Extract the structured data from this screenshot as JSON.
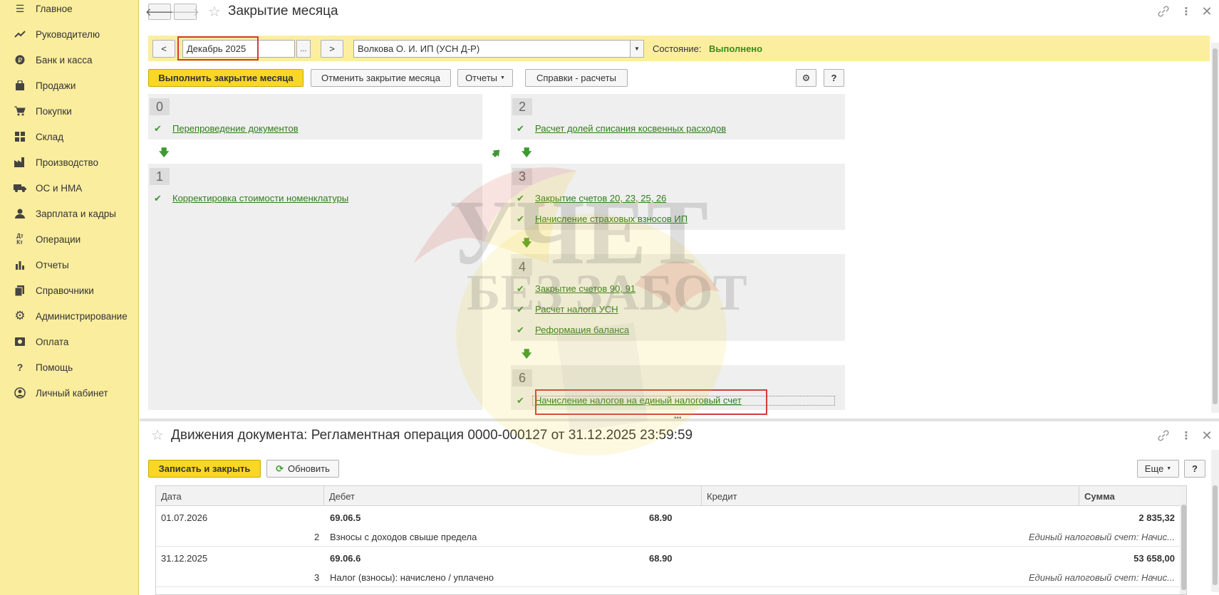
{
  "sidebar": {
    "items": [
      {
        "label": "Главное",
        "icon": "menu-icon"
      },
      {
        "label": "Руководителю",
        "icon": "trend-icon"
      },
      {
        "label": "Банк и касса",
        "icon": "ruble-icon"
      },
      {
        "label": "Продажи",
        "icon": "bag-icon"
      },
      {
        "label": "Покупки",
        "icon": "cart-icon"
      },
      {
        "label": "Склад",
        "icon": "warehouse-icon"
      },
      {
        "label": "Производство",
        "icon": "factory-icon"
      },
      {
        "label": "ОС и НМА",
        "icon": "truck-icon"
      },
      {
        "label": "Зарплата и кадры",
        "icon": "person-icon"
      },
      {
        "label": "Операции",
        "icon": "debit-credit-icon"
      },
      {
        "label": "Отчеты",
        "icon": "bar-chart-icon"
      },
      {
        "label": "Справочники",
        "icon": "books-icon"
      },
      {
        "label": "Администрирование",
        "icon": "gear-icon"
      },
      {
        "label": "Оплата",
        "icon": "payment-icon"
      },
      {
        "label": "Помощь",
        "icon": "question-icon"
      },
      {
        "label": "Личный кабинет",
        "icon": "account-icon"
      }
    ]
  },
  "top_form": {
    "title": "Закрытие месяца",
    "period_prev": "<",
    "period_value": "Декабрь 2025",
    "period_select": "...",
    "period_next": ">",
    "organization": "Волкова О. И. ИП (УСН Д-Р)",
    "state_label": "Состояние:",
    "state_value": "Выполнено",
    "state_color": "#3a8a1c",
    "buttons": {
      "run": "Выполнить закрытие месяца",
      "cancel": "Отменить закрытие месяца",
      "reports": "Отчеты",
      "calcs": "Справки - расчеты",
      "help": "?"
    },
    "steps": [
      {
        "num": "0",
        "ops": [
          "Перепроведение документов"
        ]
      },
      {
        "num": "1",
        "ops": [
          "Корректировка стоимости номенклатуры"
        ]
      },
      {
        "num": "2",
        "ops": [
          "Расчет долей списания косвенных расходов"
        ]
      },
      {
        "num": "3",
        "ops": [
          "Закрытие счетов 20, 23, 25, 26",
          "Начисление страховых взносов ИП"
        ]
      },
      {
        "num": "4",
        "ops": [
          "Закрытие счетов 90, 91",
          "Расчет налога УСН",
          "Реформация баланса"
        ]
      },
      {
        "num": "6",
        "ops": [
          "Начисление налогов на единый налоговый счет"
        ]
      }
    ]
  },
  "bottom_form": {
    "title": "Движения документа: Регламентная операция 0000-000127 от 31.12.2025 23:59:59",
    "save_close": "Записать и закрыть",
    "refresh": "Обновить",
    "more": "Еще",
    "help": "?",
    "columns": [
      "Дата",
      "Дебет",
      "Кредит",
      "Сумма"
    ],
    "rows": [
      {
        "date": "01.07.2026",
        "num": "2",
        "debit": "69.06.5",
        "debit_sub": "Взносы с доходов свыше предела",
        "credit": "68.90",
        "credit_sub": "Единый налоговый счет: Начис...",
        "sum": "2 835,32"
      },
      {
        "date": "31.12.2025",
        "num": "3",
        "debit": "69.06.6",
        "debit_sub": "Налог (взносы): начислено / уплачено",
        "credit": "68.90",
        "credit_sub": "Единый налоговый счет: Начис...",
        "sum": "53 658,00"
      }
    ]
  },
  "watermark": {
    "line1": "УЧЕТ",
    "line2": "БЕЗ ЗАБОТ"
  },
  "colors": {
    "accent_yellow": "#f9d724",
    "sidebar": "#fbed9e",
    "link_green": "#2e7d1a",
    "highlight_red": "#d9383f"
  }
}
